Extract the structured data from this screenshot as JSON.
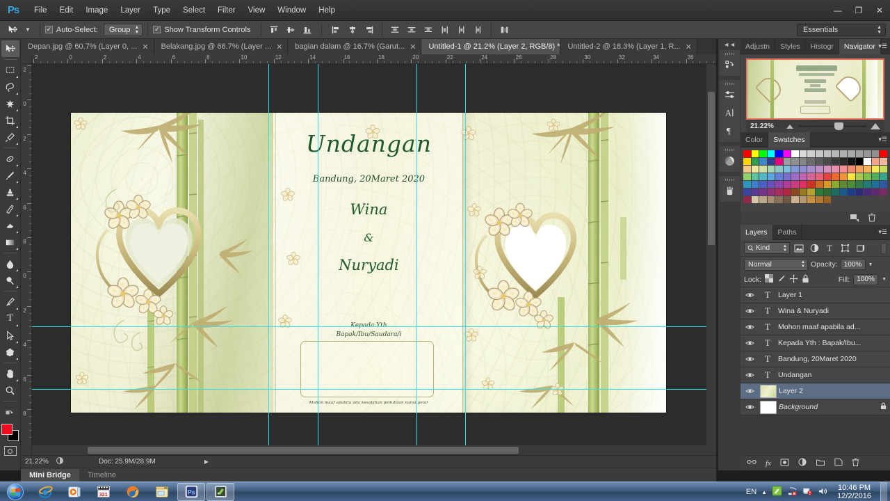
{
  "app": {
    "name": "Adobe Photoshop CS6",
    "logo": "Ps"
  },
  "menubar": {
    "items": [
      "File",
      "Edit",
      "Image",
      "Layer",
      "Type",
      "Select",
      "Filter",
      "View",
      "Window",
      "Help"
    ],
    "window_controls": {
      "minimize": "—",
      "restore": "❐",
      "close": "✕"
    }
  },
  "options_bar": {
    "tool_icon": "move-tool-icon",
    "auto_select_label": "Auto-Select:",
    "auto_select_checked": "✓",
    "group_value": "Group",
    "show_transform_label": "Show Transform Controls",
    "show_transform_checked": "✓",
    "workspace": "Essentials"
  },
  "document_tabs": [
    {
      "label": "Depan.jpg @ 60.7% (Layer 0, ...",
      "active": false,
      "close": "✕"
    },
    {
      "label": "Belakang.jpg @ 66.7% (Layer ...",
      "active": false,
      "close": "✕"
    },
    {
      "label": "bagian dalam @ 16.7% (Garut...",
      "active": false,
      "close": "✕"
    },
    {
      "label": "Untitled-1 @ 21.2% (Layer 2, RGB/8) *",
      "active": true,
      "close": "✕"
    },
    {
      "label": "Untitled-2 @ 18.3% (Layer 1, R...",
      "active": false,
      "close": "✕"
    }
  ],
  "ruler": {
    "horizontal_labels": [
      "2",
      "0",
      "2",
      "4",
      "6",
      "8",
      "10",
      "12",
      "14",
      "16",
      "18",
      "20",
      "22",
      "24",
      "26",
      "28",
      "30",
      "32",
      "34",
      "36"
    ],
    "vertical_labels": [
      "2",
      "0",
      "2",
      "4",
      "6",
      "8",
      "0",
      "2",
      "4",
      "6",
      "8"
    ]
  },
  "canvas": {
    "title": "Undangan",
    "date": "Bandung, 20Maret 2020",
    "bride": "Wina",
    "ampersand": "&",
    "groom": "Nuryadi",
    "kepada_line1": "Kepada Yth",
    "kepada_line2": "Bapak/Ibu/Saudara/i",
    "footer_note": "Mohon maaf apabila ada kesalahan penulisan nama gelar",
    "guide_color": "#31e2e2"
  },
  "toolbox": {
    "tools": [
      {
        "name": "move-tool",
        "glyph": "⬈",
        "selected": true
      },
      {
        "name": "marquee-tool",
        "glyph": "▭",
        "selected": false
      },
      {
        "name": "lasso-tool",
        "glyph": "✒",
        "selected": false
      },
      {
        "name": "quick-selection-tool",
        "glyph": "✳",
        "selected": false
      },
      {
        "name": "crop-tool",
        "glyph": "⌗",
        "selected": false
      },
      {
        "name": "eyedropper-tool",
        "glyph": "✎",
        "selected": false
      },
      {
        "name": "spot-healing-brush-tool",
        "glyph": "◖",
        "selected": false
      },
      {
        "name": "brush-tool",
        "glyph": "✏",
        "selected": false
      },
      {
        "name": "clone-stamp-tool",
        "glyph": "⌶",
        "selected": false
      },
      {
        "name": "history-brush-tool",
        "glyph": "⌁",
        "selected": false
      },
      {
        "name": "eraser-tool",
        "glyph": "▰",
        "selected": false
      },
      {
        "name": "gradient-tool",
        "glyph": "◣",
        "selected": false
      },
      {
        "name": "blur-tool",
        "glyph": "💧",
        "selected": false
      },
      {
        "name": "dodge-tool",
        "glyph": "🔍",
        "selected": false
      },
      {
        "name": "pen-tool",
        "glyph": "✑",
        "selected": false
      },
      {
        "name": "type-tool",
        "glyph": "T",
        "selected": false
      },
      {
        "name": "path-selection-tool",
        "glyph": "➤",
        "selected": false
      },
      {
        "name": "custom-shape-tool",
        "glyph": "✦",
        "selected": false
      },
      {
        "name": "hand-tool",
        "glyph": "✋",
        "selected": false
      },
      {
        "name": "zoom-tool",
        "glyph": "🔍",
        "selected": false
      }
    ],
    "foreground_color": "#f40b1e",
    "background_color": "#000000"
  },
  "statusbar": {
    "zoom": "21.22%",
    "doc_info": "Doc: 25.9M/28.9M",
    "arrow": "▶"
  },
  "bottom_tabs": [
    {
      "label": "Mini Bridge",
      "active": true
    },
    {
      "label": "Timeline",
      "active": false
    }
  ],
  "icon_dock": {
    "collapse": "◄◄",
    "icons": [
      "history-icon",
      "adjustments-icon",
      "character-icon",
      "paragraph-icon",
      "color-wheel-icon",
      "brush-presets-icon"
    ]
  },
  "navigator_panel": {
    "tabs": [
      {
        "label": "Adjustn",
        "active": false
      },
      {
        "label": "Styles",
        "active": false
      },
      {
        "label": "Histogr",
        "active": false
      },
      {
        "label": "Navigator",
        "active": true
      }
    ],
    "zoom": "21.22%",
    "view_box_color": "#e8705c",
    "menu": "▾☰"
  },
  "swatches_panel": {
    "tabs": [
      {
        "label": "Color",
        "active": false
      },
      {
        "label": "Swatches",
        "active": true
      }
    ],
    "menu": "▾☰",
    "new_swatch_icon": "new-swatch-icon",
    "delete_icon": "trash-icon",
    "colors": [
      [
        "#ff0000",
        "#ffff00",
        "#00ff00",
        "#00ffff",
        "#0000ff",
        "#ff00ff",
        "#ffffff",
        "#d9d9d9",
        "#d0d0d0",
        "#c8c8c8",
        "#c0c0c0",
        "#b8b8b8",
        "#b0b0b0",
        "#a8a8a8",
        "#a0a0a0",
        "#989898",
        "#909090",
        "#ff0000"
      ],
      [
        "#ffd500",
        "#2e9e48",
        "#3a86c8",
        "#2f3f8f",
        "#e8007f",
        "#9e9e9e",
        "#8f8f8f",
        "#858585",
        "#6e6e6e",
        "#5a5a5a",
        "#4a4a4a",
        "#3a3a3a",
        "#2a2a2a",
        "#141414",
        "#000000",
        "#ffffff",
        "#f2a58a",
        "#f5b79c"
      ],
      [
        "#f0c68a",
        "#efe6a0",
        "#cfe0a4",
        "#a8d4b4",
        "#8cc9c4",
        "#7fbfdc",
        "#7f9ad6",
        "#8f8fd0",
        "#a88fd0",
        "#c08ec8",
        "#d48fbc",
        "#e890ab",
        "#ef8f92",
        "#f18a6e",
        "#f5a15c",
        "#f6b55a"
      ],
      [
        "#f4ea5c",
        "#c9e05a",
        "#8ed06a",
        "#5cc49a",
        "#4fb9c8",
        "#5aa6e0",
        "#5f7fd8",
        "#7a6fcf",
        "#a06bc8",
        "#c264b6",
        "#d86399",
        "#e8607a",
        "#ef4040",
        "#f46a2a",
        "#f59436",
        "#fbe43a"
      ],
      [
        "#a9c94c",
        "#7fbf4c",
        "#4fae5a",
        "#35a58e",
        "#2f96bd",
        "#3b7fd0",
        "#4b5fc4",
        "#6a4fb8",
        "#8f44ad",
        "#b03c98",
        "#cc3b80",
        "#e03060",
        "#d03020",
        "#cf6a22",
        "#d99a24",
        "#8aa832"
      ],
      [
        "#5f8a35",
        "#4d8a3a",
        "#2f7d4a",
        "#1f7a78",
        "#1f6ea0",
        "#2f5aa8",
        "#3b44a0",
        "#5a3a96",
        "#77338c",
        "#92307a",
        "#a82e62",
        "#b8253f",
        "#8a4a20",
        "#9a7a22",
        "#b8a030",
        "#2e7a34"
      ],
      [
        "#2f6b32",
        "#1f6a60",
        "#1b5a8c",
        "#1b3f88",
        "#2a2a7a",
        "#4a2a78",
        "#5f2a72",
        "#7a2a64",
        "#8f2a4a",
        "#d8c7a8",
        "#bda88a",
        "#a88f72",
        "#8a7358",
        "#6e5a44",
        "#cdb48e",
        "#b79a72"
      ],
      [
        "#c8903c",
        "#b07830",
        "#9a6424",
        "null",
        "null",
        "null",
        "null",
        "null",
        "null",
        "null",
        "null",
        "null",
        "null",
        "null",
        "null",
        "null",
        "null",
        "null"
      ]
    ]
  },
  "layers_panel": {
    "tabs": [
      {
        "label": "Layers",
        "active": true
      },
      {
        "label": "Paths",
        "active": false
      }
    ],
    "menu": "▾☰",
    "filter_label": "Kind",
    "filter_icons": [
      "pixel-filter-icon",
      "adjustment-filter-icon",
      "type-filter-icon",
      "shape-filter-icon",
      "smartobject-filter-icon"
    ],
    "blend_mode": "Normal",
    "opacity_label": "Opacity:",
    "opacity_value": "100%",
    "lock_label": "Lock:",
    "lock_icons": [
      "lock-transparent-icon",
      "lock-image-icon",
      "lock-position-icon",
      "lock-all-icon"
    ],
    "fill_label": "Fill:",
    "fill_value": "100%",
    "rows": [
      {
        "name": "Layer 1",
        "type": "text",
        "visible": true,
        "selected": false,
        "locked": false
      },
      {
        "name": "Wina & Nuryadi",
        "type": "text",
        "visible": true,
        "selected": false,
        "locked": false
      },
      {
        "name": "Mohon maaf apabila ad...",
        "type": "text",
        "visible": true,
        "selected": false,
        "locked": false
      },
      {
        "name": "Kepada Yth : Bapak/Ibu...",
        "type": "text",
        "visible": true,
        "selected": false,
        "locked": false
      },
      {
        "name": "Bandung, 20Maret 2020",
        "type": "text",
        "visible": true,
        "selected": false,
        "locked": false
      },
      {
        "name": "Undangan",
        "type": "text",
        "visible": true,
        "selected": false,
        "locked": false
      },
      {
        "name": "Layer 2",
        "type": "image",
        "visible": true,
        "selected": true,
        "locked": false
      },
      {
        "name": "Background",
        "type": "white",
        "visible": true,
        "selected": false,
        "locked": true
      }
    ],
    "footer_icons": [
      "link-layers-icon",
      "layer-style-icon",
      "layer-mask-icon",
      "adjustment-layer-icon",
      "new-group-icon",
      "new-layer-icon",
      "delete-layer-icon"
    ]
  },
  "taskbar": {
    "start": "start-orb-icon",
    "items": [
      {
        "name": "internet-explorer-icon",
        "open": false
      },
      {
        "name": "windows-media-player-icon",
        "open": false
      },
      {
        "name": "media-player-classic-icon",
        "open": false
      },
      {
        "name": "firefox-icon",
        "open": false
      },
      {
        "name": "notepad-icon",
        "open": false
      },
      {
        "name": "photoshop-icon",
        "open": true
      },
      {
        "name": "screen-recorder-icon",
        "open": true
      }
    ],
    "tray": {
      "language": "EN",
      "show_hidden": "▲",
      "icons": [
        "green-app-icon",
        "network-icon",
        "action-center-icon",
        "volume-icon"
      ],
      "time": "10:46 PM",
      "date": "12/2/2016"
    }
  }
}
